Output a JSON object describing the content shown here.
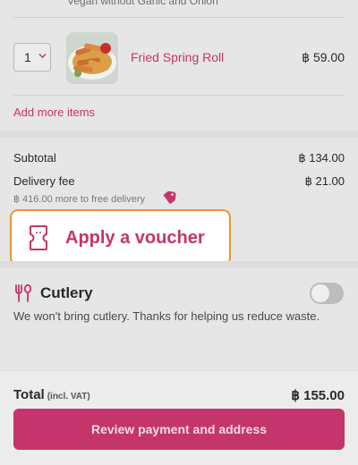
{
  "prev_item": {
    "note": "Vegan without Garlic and Onion"
  },
  "cart_item": {
    "quantity": "1",
    "name": "Fried Spring Roll",
    "price": "฿ 59.00",
    "image_icon": "food-photo-spring-rolls"
  },
  "add_more_label": "Add more items",
  "summary": {
    "subtotal_label": "Subtotal",
    "subtotal_value": "฿ 134.00",
    "delivery_label": "Delivery fee",
    "delivery_value": "฿ 21.00",
    "free_delivery_note": "฿ 416.00 more to free delivery"
  },
  "voucher": {
    "label": "Apply a voucher",
    "icon": "ticket-icon"
  },
  "cutlery": {
    "title": "Cutlery",
    "description": "We won't bring cutlery. Thanks for helping us reduce waste.",
    "enabled": false
  },
  "footer": {
    "total_label": "Total",
    "total_note": "(incl. VAT)",
    "total_value": "฿ 155.00",
    "cta_label": "Review payment and address"
  },
  "colors": {
    "brand": "#c4356b",
    "highlight": "#e39a2e",
    "background": "#e6e6e6"
  }
}
